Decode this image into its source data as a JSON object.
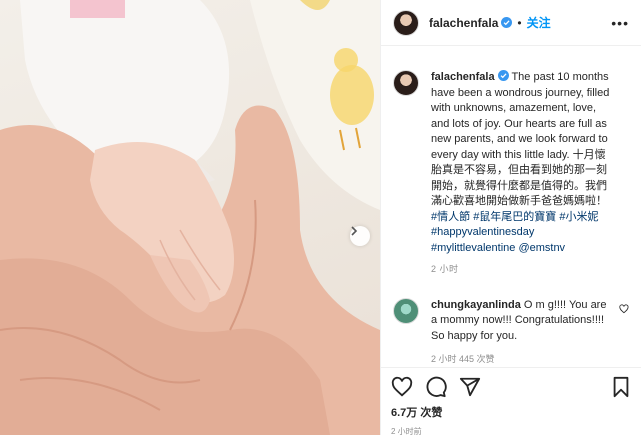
{
  "post": {
    "username": "falachenfala",
    "follow_label": "关注",
    "separator": "•",
    "more_label": "•••"
  },
  "caption": {
    "username": "falachenfala",
    "text": " The past 10 months have been a wondrous journey, filled with unknowns, amazement, love, and lots of joy. Our hearts are full as new parents, and we look forward to every day with this little lady. 十月懷胎真是不容易，但由看到她的那一刻開始，就覺得什麼都是值得的。我們滿心歡喜地開始做新手爸爸媽媽啦！",
    "tags": [
      "#情人節",
      "#鼠年尾巴的寶寶",
      "#小米妮",
      "#happyvalentinesday",
      "#mylittlevalentine",
      "@emstnv"
    ],
    "time": "2 小时"
  },
  "reply": {
    "username": "chungkayanlinda",
    "text": " O m g!!!! You are a mommy now!!! Congratulations!!!! So happy for you.",
    "meta": "2 小时   445 次赞"
  },
  "actions": {
    "likes": "6.7万 次赞",
    "time": "2 小时前"
  },
  "colors": {
    "accent": "#0095f6",
    "verified": "#3897f0",
    "text": "#262626",
    "muted": "#8e8e8e"
  }
}
